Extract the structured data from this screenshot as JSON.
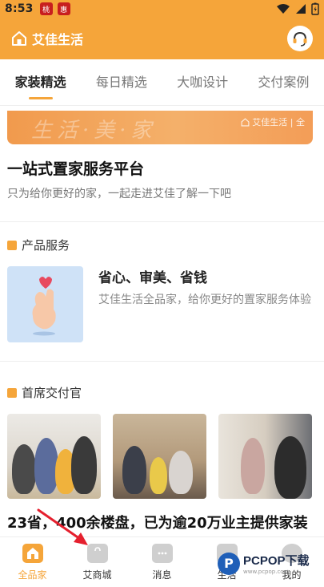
{
  "status_bar": {
    "time": "8:53",
    "app_icons": [
      "桃",
      "惠"
    ]
  },
  "header": {
    "app_title": "艾佳生活",
    "icons": {
      "home": "home-outline-icon",
      "support": "headset-icon"
    }
  },
  "tabs": [
    {
      "label": "家装精选",
      "active": true
    },
    {
      "label": "每日精选",
      "active": false
    },
    {
      "label": "大咖设计",
      "active": false
    },
    {
      "label": "交付案例",
      "active": false
    }
  ],
  "banner": {
    "brand_mark": "艾佳生活 | 全",
    "script_text": "生活·美·家"
  },
  "intro": {
    "title": "一站式置家服务平台",
    "subtitle": "只为给你更好的家，一起走进艾佳了解一下吧"
  },
  "product_section": {
    "heading": "产品服务",
    "card": {
      "title": "省心、审美、省钱",
      "description": "艾佳生活全品家，给你更好的置家服务体验"
    }
  },
  "delivery_section": {
    "heading": "首席交付官",
    "headline": "23省，400余楼盘，已为逾20万业主提供家装"
  },
  "bottom_nav": [
    {
      "label": "全品家",
      "icon": "home-icon",
      "active": true
    },
    {
      "label": "艾商城",
      "icon": "shopping-bag-icon",
      "active": false
    },
    {
      "label": "消息",
      "icon": "chat-bubble-icon",
      "active": false
    },
    {
      "label": "生活",
      "icon": "life-icon",
      "active": false
    },
    {
      "label": "我的",
      "icon": "profile-icon",
      "active": false
    }
  ],
  "watermark": {
    "text": "PCPOP下载",
    "sub": "www.pcpop.com"
  },
  "colors": {
    "accent": "#f5a53a",
    "annotation_arrow": "#e5202e"
  }
}
